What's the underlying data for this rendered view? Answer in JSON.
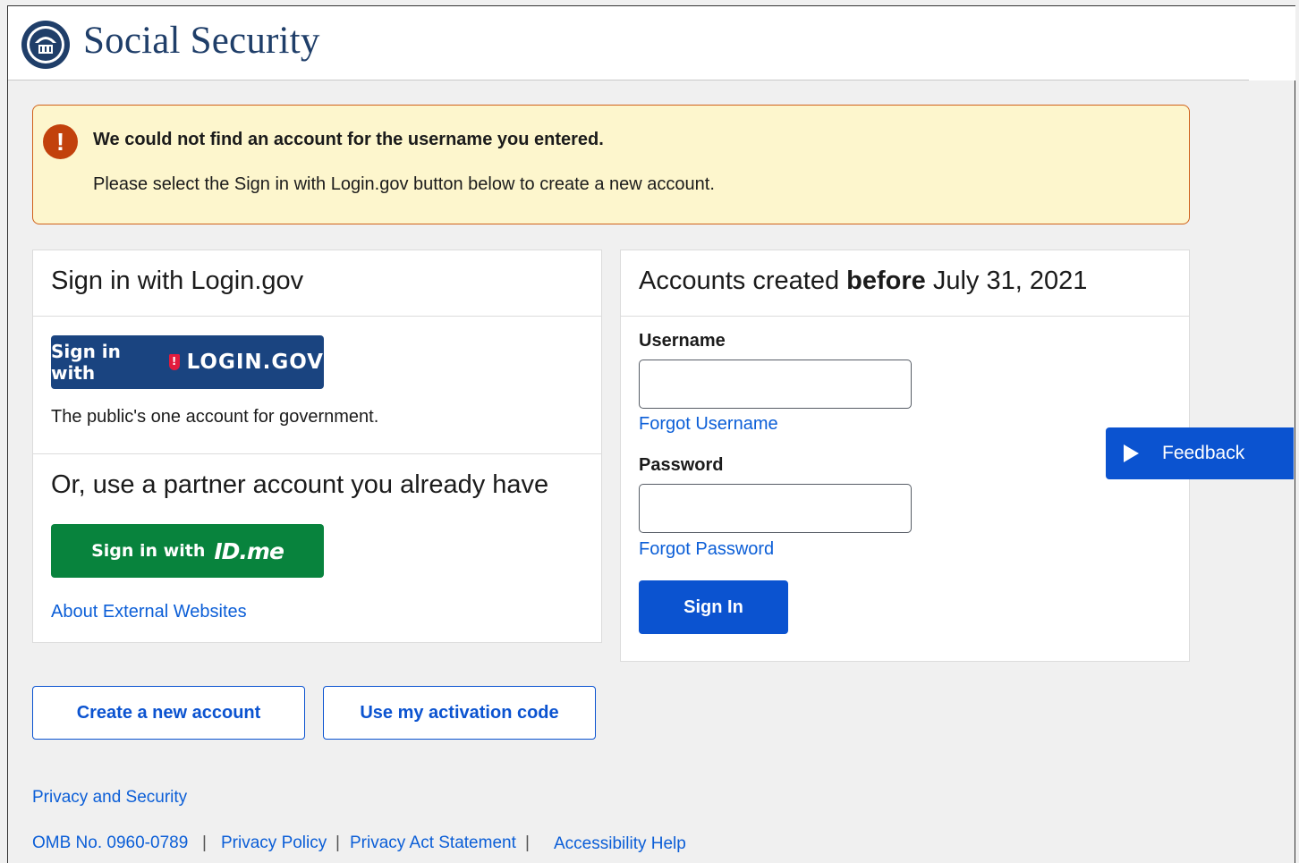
{
  "header": {
    "brand": "Social Security",
    "logo_icon": "ssa-seal-icon"
  },
  "alert": {
    "icon": "exclamation-icon",
    "title": "We could not find an account for the username you entered.",
    "message": "Please select the Sign in with Login.gov button below to create a new account."
  },
  "left_panel": {
    "title": "Sign in with Login.gov",
    "login_button": {
      "prefix": "Sign in with",
      "brand": "LOGIN.GOV"
    },
    "login_caption": "The public's one account for government.",
    "partner_title": "Or, use a partner account you already have",
    "idme_button": {
      "prefix": "Sign in with",
      "brand": "ID.me"
    },
    "external_link": "About External Websites"
  },
  "right_panel": {
    "title_pre": "Accounts created ",
    "title_bold": "before",
    "title_post": " July 31, 2021",
    "username_label": "Username",
    "username_value": "",
    "forgot_username": "Forgot Username",
    "password_label": "Password",
    "password_value": "",
    "forgot_password": "Forgot Password",
    "signin_button": "Sign In"
  },
  "actions": {
    "create_account": "Create a new account",
    "activation_code": "Use my activation code"
  },
  "feedback": {
    "label": "Feedback",
    "icon": "play-icon"
  },
  "footer": {
    "privacy_security": "Privacy and Security",
    "omb": "OMB No. 0960-0789",
    "privacy_policy": "Privacy Policy",
    "privacy_act": "Privacy Act Statement",
    "accessibility": "Accessibility Help",
    "separator": "|"
  },
  "colors": {
    "brand_navy": "#1f3e69",
    "primary_blue": "#0b53d0",
    "login_gov_blue": "#1a4480",
    "idme_green": "#08833d",
    "alert_bg": "#fdf6cd",
    "alert_border": "#d0621a"
  }
}
